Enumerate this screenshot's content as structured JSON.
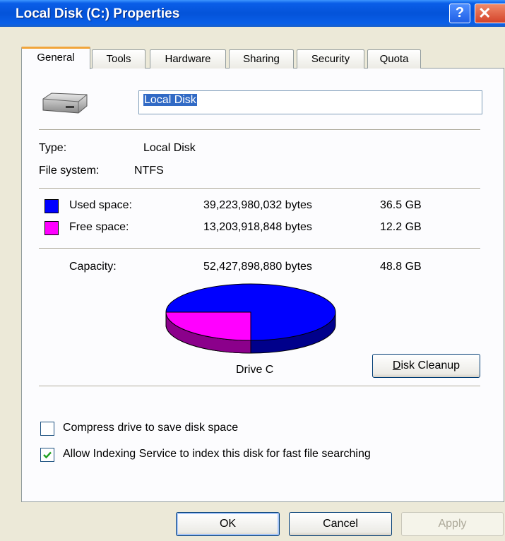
{
  "window": {
    "title": "Local Disk (C:) Properties",
    "help_symbol": "?",
    "close_symbol": "✕"
  },
  "tabs": [
    {
      "label": "General"
    },
    {
      "label": "Tools"
    },
    {
      "label": "Hardware"
    },
    {
      "label": "Sharing"
    },
    {
      "label": "Security"
    },
    {
      "label": "Quota"
    }
  ],
  "general": {
    "name_value": "Local Disk",
    "type_label": "Type:",
    "type_value": "Local Disk",
    "fs_label": "File system:",
    "fs_value": "NTFS",
    "used_label": "Used space:",
    "used_bytes": "39,223,980,032 bytes",
    "used_gb": "36.5 GB",
    "free_label": "Free space:",
    "free_bytes": "13,203,918,848 bytes",
    "free_gb": "12.2 GB",
    "capacity_label": "Capacity:",
    "capacity_bytes": "52,427,898,880 bytes",
    "capacity_gb": "48.8 GB",
    "drive_label": "Drive C",
    "cleanup_button": "Disk Cleanup",
    "compress_label": "Compress drive to save disk space",
    "compress_checked": false,
    "index_label": "Allow Indexing Service to index this disk for fast file searching",
    "index_checked": true
  },
  "colors": {
    "used": "#0000ff",
    "free": "#ff00ff"
  },
  "icons": {
    "drive": "hard-drive-icon",
    "check": "checkmark-icon"
  },
  "buttons": {
    "ok": "OK",
    "cancel": "Cancel",
    "apply": "Apply"
  }
}
